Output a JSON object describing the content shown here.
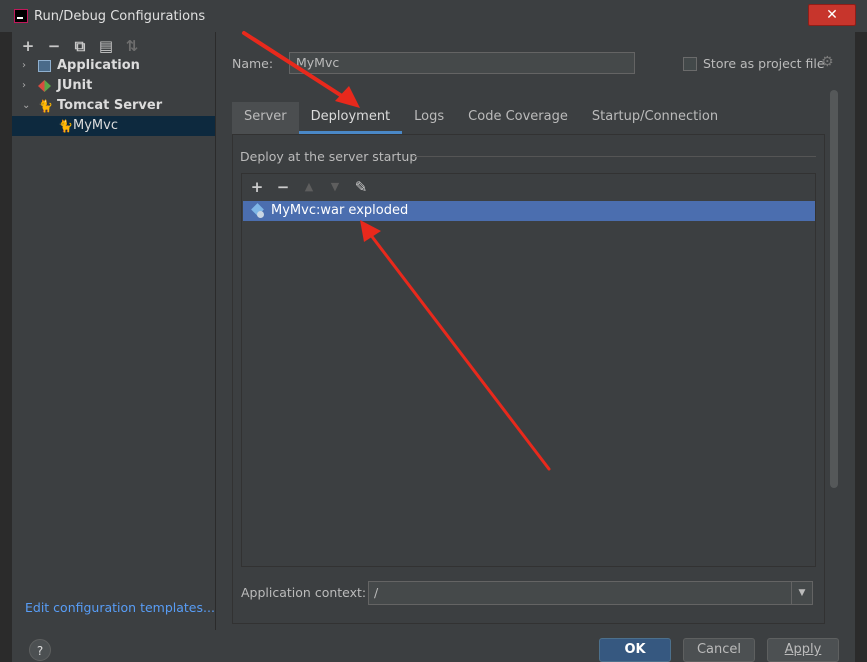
{
  "window": {
    "title": "Run/Debug Configurations",
    "close_glyph": "✕"
  },
  "left_toolbar": {
    "add": "+",
    "remove": "−",
    "copy": "⧉",
    "folder": "▤",
    "sort": "⇅"
  },
  "tree": {
    "items": [
      {
        "label": "Application",
        "arrow": "›"
      },
      {
        "label": "JUnit",
        "arrow": "›"
      },
      {
        "label": "Tomcat Server",
        "arrow": "⌄"
      },
      {
        "label": "MyMvc"
      }
    ]
  },
  "edit_templates": "Edit configuration templates...",
  "name": {
    "label": "Name:",
    "value": "MyMvc"
  },
  "store": {
    "label": "Store as project file",
    "gear": "⚙"
  },
  "tabs": [
    "Server",
    "Deployment",
    "Logs",
    "Code Coverage",
    "Startup/Connection"
  ],
  "deploy": {
    "section_title": "Deploy at the server startup",
    "toolbar": {
      "add": "+",
      "remove": "−",
      "up": "▲",
      "down": "▼",
      "edit": "✎"
    },
    "items": [
      "MyMvc:war exploded"
    ]
  },
  "context": {
    "label": "Application context:",
    "value": "/",
    "arrow": "▼"
  },
  "buttons": {
    "help": "?",
    "ok": "OK",
    "cancel": "Cancel",
    "apply": "Apply"
  },
  "colors": {
    "annotation_arrow": "#e8291c",
    "selection": "#4b6eaf",
    "accent": "#4a88c7"
  }
}
